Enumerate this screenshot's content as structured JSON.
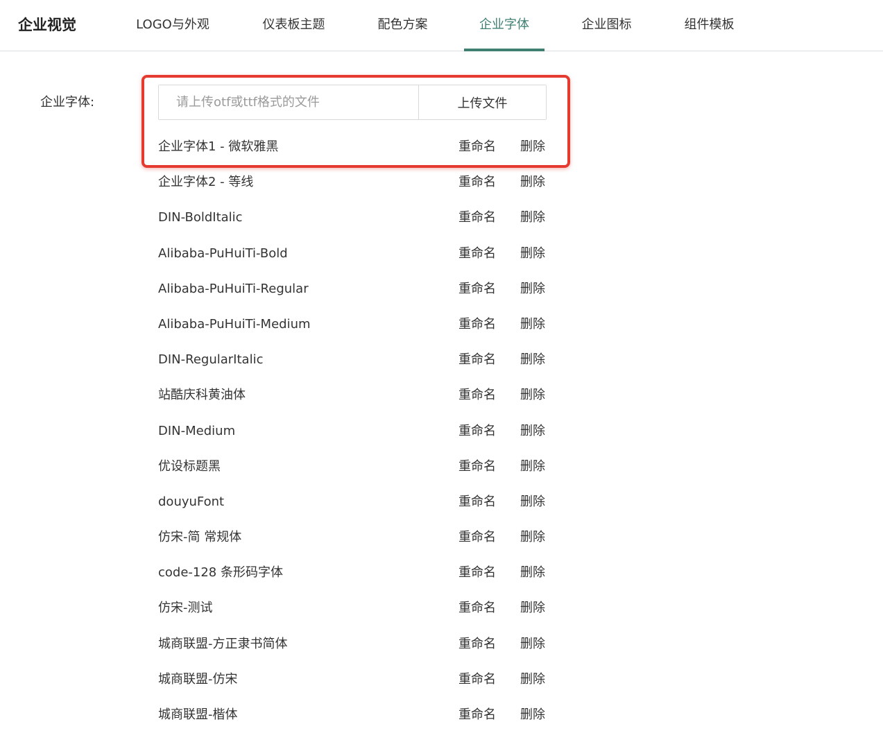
{
  "header": {
    "brand": "企业视觉",
    "tabs": [
      {
        "label": "LOGO与外观",
        "active": false
      },
      {
        "label": "仪表板主题",
        "active": false
      },
      {
        "label": "配色方案",
        "active": false
      },
      {
        "label": "企业字体",
        "active": true
      },
      {
        "label": "企业图标",
        "active": false
      },
      {
        "label": "组件模板",
        "active": false
      }
    ]
  },
  "font_section": {
    "label": "企业字体:",
    "upload_placeholder": "请上传otf或ttf格式的文件",
    "upload_button": "上传文件",
    "rename_label": "重命名",
    "delete_label": "删除",
    "fonts": [
      "企业字体1 - 微软雅黑",
      "企业字体2 - 等线",
      "DIN-BoldItalic",
      "Alibaba-PuHuiTi-Bold",
      "Alibaba-PuHuiTi-Regular",
      "Alibaba-PuHuiTi-Medium",
      "DIN-RegularItalic",
      "站酷庆科黄油体",
      "DIN-Medium",
      "优设标题黑",
      "douyuFont",
      "仿宋-简 常规体",
      "code-128 条形码字体",
      "仿宋-测试",
      "城商联盟-方正隶书简体",
      "城商联盟-仿宋",
      "城商联盟-楷体"
    ]
  },
  "colors": {
    "accent": "#3f7f72",
    "highlight": "#e53a2f",
    "text": "#333333",
    "placeholder": "#9a9a9a",
    "border": "#d9d9d9"
  }
}
